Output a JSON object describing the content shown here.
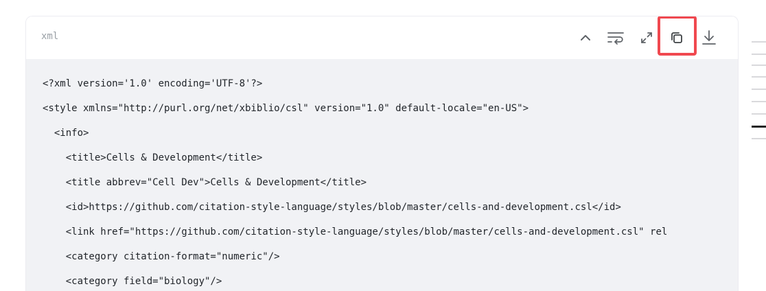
{
  "code_block": {
    "language": "xml",
    "toolbar": {
      "collapse_icon": "chevron-up-icon",
      "wrap_icon": "word-wrap-icon",
      "expand_icon": "expand-icon",
      "copy_icon": "copy-icon",
      "download_icon": "download-icon"
    },
    "lines": [
      "<?xml version='1.0' encoding='UTF-8'?>",
      "<style xmlns=\"http://purl.org/net/xbiblio/csl\" version=\"1.0\" default-locale=\"en-US\">",
      "  <info>",
      "    <title>Cells & Development</title>",
      "    <title abbrev=\"Cell Dev\">Cells & Development</title>",
      "    <id>https://github.com/citation-style-language/styles/blob/master/cells-and-development.csl</id>",
      "    <link href=\"https://github.com/citation-style-language/styles/blob/master/cells-and-development.csl\" rel",
      "    <category citation-format=\"numeric\"/>",
      "    <category field=\"biology\"/>"
    ]
  },
  "colors": {
    "header_bg": "#ffffff",
    "code_bg": "#f1f2f5",
    "highlight": "#f0484f",
    "icon": "#5f6368"
  }
}
